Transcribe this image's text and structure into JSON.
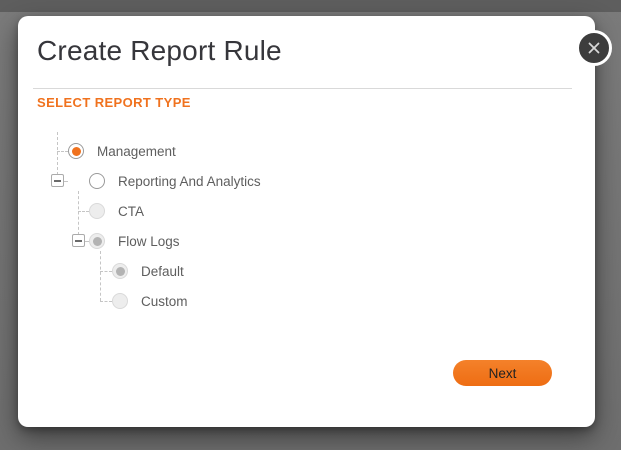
{
  "dialog": {
    "title": "Create Report Rule",
    "section_heading": "SELECT REPORT TYPE",
    "buttons": {
      "next": "Next"
    }
  },
  "tree": {
    "items": [
      {
        "label": "Management",
        "level": 0,
        "selected": true,
        "enabled": true,
        "has_expander": false
      },
      {
        "label": "Reporting And Analytics",
        "level": 0,
        "selected": false,
        "enabled": true,
        "has_expander": true,
        "expanded": true
      },
      {
        "label": "CTA",
        "level": 1,
        "selected": false,
        "enabled": false,
        "has_expander": false
      },
      {
        "label": "Flow Logs",
        "level": 1,
        "selected": true,
        "enabled": false,
        "has_expander": true,
        "expanded": true
      },
      {
        "label": "Default",
        "level": 2,
        "selected": true,
        "enabled": false,
        "has_expander": false
      },
      {
        "label": "Custom",
        "level": 2,
        "selected": false,
        "enabled": false,
        "has_expander": false
      }
    ]
  },
  "colors": {
    "accent_orange": "#F0721E",
    "title_text": "#36363B",
    "label_text": "#5E5E5E",
    "disabled_radio_fill": "#EDEDED",
    "disabled_radio_dot": "#B3B3B3",
    "close_button_fill": "#3D3D3D",
    "backdrop": "#717171"
  }
}
